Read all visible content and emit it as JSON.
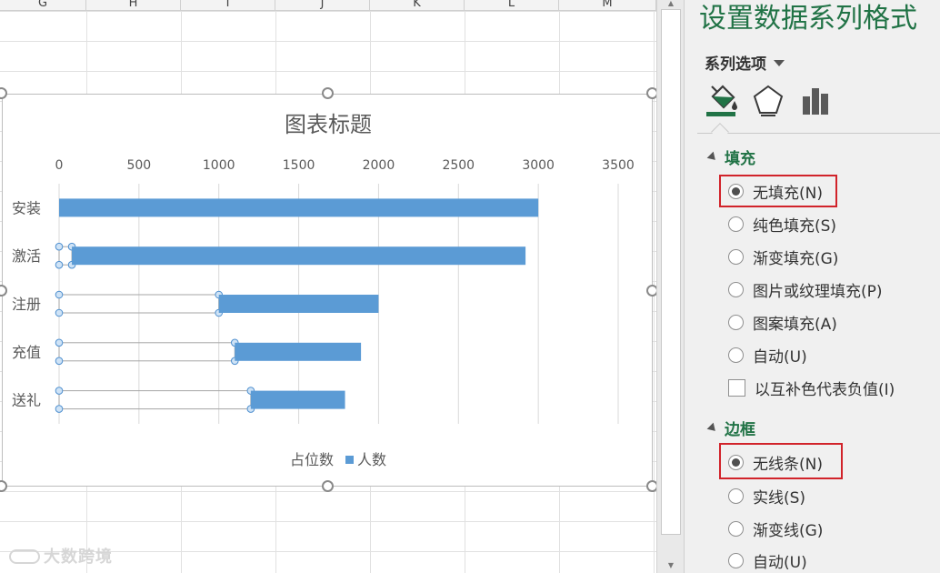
{
  "sheet": {
    "columns": [
      "G",
      "H",
      "I",
      "J",
      "K",
      "L",
      "M"
    ]
  },
  "watermark": {
    "text": "大数跨境"
  },
  "chart_data": {
    "type": "bar",
    "orientation": "horizontal",
    "stacked": true,
    "title": "图表标题",
    "categories": [
      "安装",
      "激活",
      "注册",
      "充值",
      "送礼"
    ],
    "series": [
      {
        "name": "占位数",
        "values": [
          0,
          80,
          1000,
          1100,
          1200
        ],
        "fill": "none"
      },
      {
        "name": "人数",
        "values": [
          3000,
          2840,
          1000,
          790,
          590
        ],
        "color": "#5b9bd5"
      }
    ],
    "xlim": [
      0,
      3500
    ],
    "xticks": [
      0,
      500,
      1000,
      1500,
      2000,
      2500,
      3000,
      3500
    ],
    "x_axis_position": "top",
    "grid": true,
    "legend": "bottom",
    "selected_series": "占位数"
  },
  "pane": {
    "title": "设置数据系列格式",
    "series_options_label": "系列选项",
    "tabs": [
      {
        "icon": "paint-bucket-icon"
      },
      {
        "icon": "pentagon-icon"
      },
      {
        "icon": "bar-chart-icon"
      }
    ],
    "fill": {
      "heading": "填充",
      "options": [
        {
          "label": "无填充(N)",
          "checked": true
        },
        {
          "label": "纯色填充(S)",
          "checked": false
        },
        {
          "label": "渐变填充(G)",
          "checked": false
        },
        {
          "label": "图片或纹理填充(P)",
          "checked": false
        },
        {
          "label": "图案填充(A)",
          "checked": false
        },
        {
          "label": "自动(U)",
          "checked": false
        }
      ],
      "invert_label": "以互补色代表负值(I)"
    },
    "border": {
      "heading": "边框",
      "options": [
        {
          "label": "无线条(N)",
          "checked": true
        },
        {
          "label": "实线(S)",
          "checked": false
        },
        {
          "label": "渐变线(G)",
          "checked": false
        },
        {
          "label": "自动(U)",
          "checked": false
        }
      ]
    },
    "accent_color": "#217346",
    "highlight_color": "#d1232a"
  }
}
